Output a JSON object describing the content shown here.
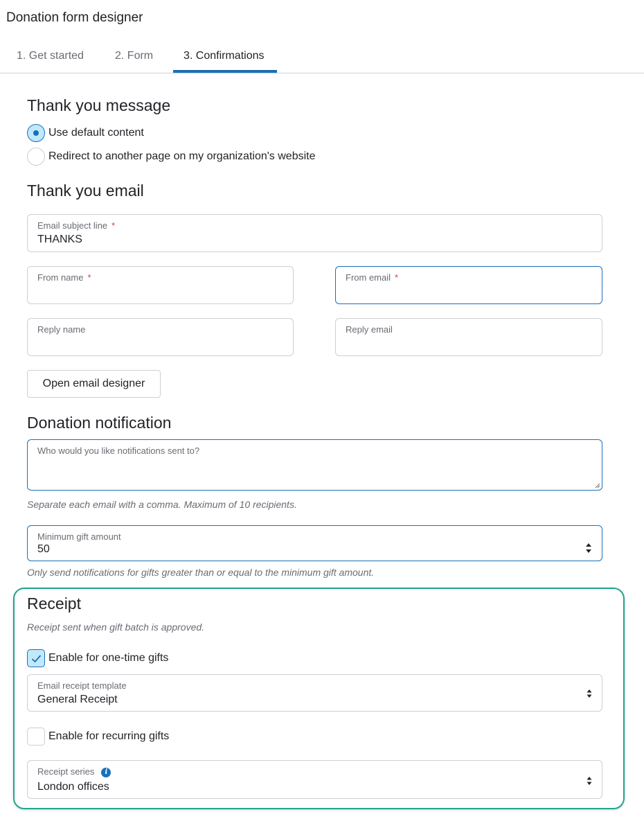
{
  "page": {
    "title": "Donation form designer"
  },
  "tabs": [
    {
      "label": "1. Get started"
    },
    {
      "label": "2. Form"
    },
    {
      "label": "3. Confirmations",
      "active": true
    }
  ],
  "thank_you_message": {
    "heading": "Thank you message",
    "options": [
      {
        "label": "Use default content",
        "selected": true
      },
      {
        "label": "Redirect to another page on my organization's website",
        "selected": false
      }
    ]
  },
  "thank_you_email": {
    "heading": "Thank you email",
    "subject": {
      "label": "Email subject line",
      "required_mark": "*",
      "value": "THANKS"
    },
    "from_name": {
      "label": "From name",
      "required_mark": "*",
      "value": ""
    },
    "from_email": {
      "label": "From email",
      "required_mark": "*",
      "value": ""
    },
    "reply_name": {
      "label": "Reply name",
      "value": ""
    },
    "reply_email": {
      "label": "Reply email",
      "value": ""
    },
    "designer_button": "Open email designer"
  },
  "donation_notification": {
    "heading": "Donation notification",
    "recipients": {
      "label": "Who would you like notifications sent to?",
      "value": ""
    },
    "recipients_hint": "Separate each email with a comma. Maximum of 10 recipients.",
    "minimum_gift": {
      "label": "Minimum gift amount",
      "value": "50"
    },
    "minimum_hint": "Only send notifications for gifts greater than or equal to the minimum gift amount."
  },
  "receipt": {
    "heading": "Receipt",
    "subtitle": "Receipt sent when gift batch is approved.",
    "one_time": {
      "label": "Enable for one-time gifts",
      "checked": true
    },
    "template": {
      "label": "Email receipt template",
      "value": "General Receipt"
    },
    "recurring": {
      "label": "Enable for recurring gifts",
      "checked": false
    },
    "series": {
      "label": "Receipt series",
      "value": "London offices",
      "info_icon": "i"
    }
  },
  "colors": {
    "accent": "#1870b8",
    "highlight_border": "#21a58f",
    "required": "#e23a3a",
    "checked_fill": "#c1e8fb"
  }
}
